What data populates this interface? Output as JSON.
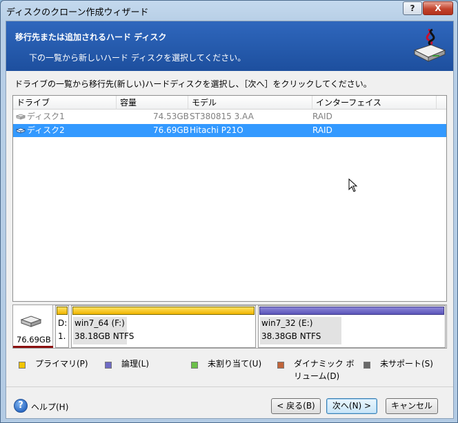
{
  "window": {
    "title": "ディスクのクローン作成ウィザード",
    "help_btn": "?",
    "close_btn": "X"
  },
  "header": {
    "title": "移行先または追加されるハード ディスク",
    "subtitle": "下の一覧から新しいハード ディスクを選択してください。"
  },
  "instruction": "ドライブの一覧から移行先(新しい)ハードディスクを選択し、［次へ］をクリックしてください。",
  "table": {
    "columns": [
      "ドライブ",
      "容量",
      "モデル",
      "インターフェイス"
    ],
    "rows": [
      {
        "drive": "ディスク1",
        "capacity": "74.53GB",
        "model": "ST380815 3.AA",
        "interface": "RAID",
        "selected": false
      },
      {
        "drive": "ディスク2",
        "capacity": "76.69GB",
        "model": "Hitachi P21O",
        "interface": "RAID",
        "selected": true
      }
    ]
  },
  "diskmap": {
    "disk_size": "76.69GB",
    "small_part": {
      "line1": "D:",
      "line2": "1."
    },
    "partitions": [
      {
        "name": "win7_64 (F:)",
        "size": "38.18GB  NTFS",
        "type": "primary"
      },
      {
        "name": "win7_32 (E:)",
        "size": "38.38GB  NTFS",
        "type": "logical"
      }
    ]
  },
  "legend": [
    {
      "label": "プライマリ(P)",
      "color": "#f2c400"
    },
    {
      "label": "論理(L)",
      "color": "#6f6bc4"
    },
    {
      "label": "未割り当て(U)",
      "color": "#6cc04a"
    },
    {
      "label_line1": "ダイナミック ボ",
      "label_line2": "リューム(D)",
      "color": "#c0643a"
    },
    {
      "label": "未サポート(S)",
      "color": "#6a6a6a"
    }
  ],
  "footer": {
    "help_label": "ヘルプ(H)",
    "back_label": "< 戻る(B)",
    "next_label": "次へ(N) >",
    "cancel_label": "キャンセル"
  },
  "colors": {
    "header_bg": "#2a5fb3",
    "selection": "#3399ff"
  }
}
